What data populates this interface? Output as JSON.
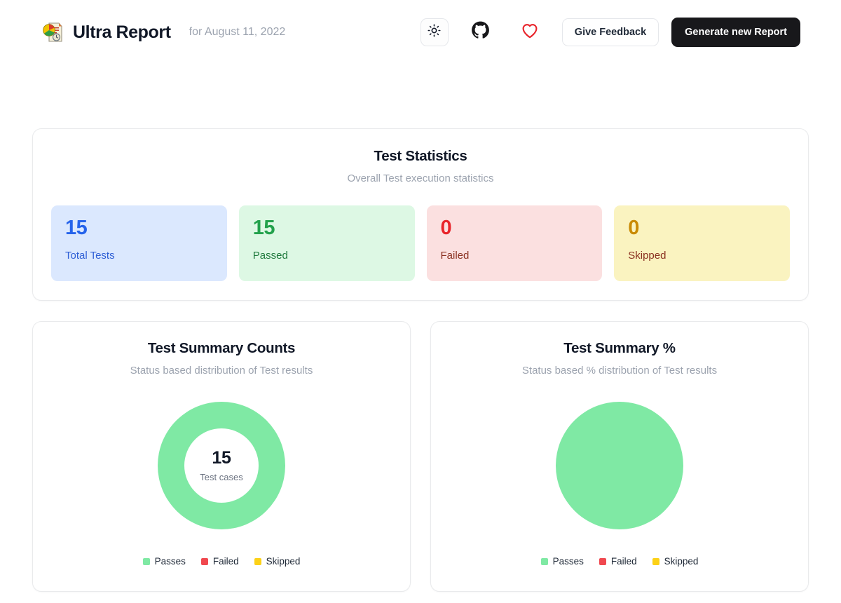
{
  "header": {
    "logo_icon": "pie-chart-report-icon",
    "title": "Ultra Report",
    "subtitle": "for August 11, 2022",
    "theme_toggle_icon": "sun-icon",
    "github_icon": "github-icon",
    "heart_icon": "heart-icon",
    "feedback_label": "Give Feedback",
    "generate_label": "Generate new Report"
  },
  "stats": {
    "title": "Test Statistics",
    "subtitle": "Overall Test execution statistics",
    "items": [
      {
        "value": "15",
        "label": "Total Tests",
        "bg": "#dbe8fe",
        "value_color": "#2563eb"
      },
      {
        "value": "15",
        "label": "Passed",
        "bg": "#ddf8e4",
        "value_color": "#22a14b"
      },
      {
        "value": "0",
        "label": "Failed",
        "bg": "#fbe0e0",
        "value_color": "#e8232a"
      },
      {
        "value": "0",
        "label": "Skipped",
        "bg": "#faf3c0",
        "value_color": "#c98a04"
      }
    ]
  },
  "counts_chart": {
    "title": "Test Summary Counts",
    "subtitle": "Status based distribution of Test results",
    "center_value": "15",
    "center_caption": "Test cases",
    "legend": [
      {
        "label": "Passes",
        "color": "#7fe9a4"
      },
      {
        "label": "Failed",
        "color": "#f0484f"
      },
      {
        "label": "Skipped",
        "color": "#fcd117"
      }
    ]
  },
  "percent_chart": {
    "title": "Test Summary %",
    "subtitle": "Status based % distribution of Test results",
    "legend": [
      {
        "label": "Passes",
        "color": "#7fe9a4"
      },
      {
        "label": "Failed",
        "color": "#f0484f"
      },
      {
        "label": "Skipped",
        "color": "#fcd117"
      }
    ]
  },
  "chart_data": [
    {
      "type": "pie",
      "title": "Test Summary Counts",
      "subtitle": "Status based distribution of Test results",
      "variant": "donut",
      "center_label": "15",
      "center_sublabel": "Test cases",
      "labels": [
        "Passes",
        "Failed",
        "Skipped"
      ],
      "values": [
        15,
        0,
        0
      ],
      "colors": [
        "#7fe9a4",
        "#f0484f",
        "#fcd117"
      ],
      "legend_position": "bottom",
      "total": 15
    },
    {
      "type": "pie",
      "title": "Test Summary %",
      "subtitle": "Status based % distribution of Test results",
      "variant": "pie",
      "labels": [
        "Passes",
        "Failed",
        "Skipped"
      ],
      "values": [
        100,
        0,
        0
      ],
      "unit": "%",
      "colors": [
        "#7fe9a4",
        "#f0484f",
        "#fcd117"
      ],
      "legend_position": "bottom",
      "total": 100
    }
  ]
}
